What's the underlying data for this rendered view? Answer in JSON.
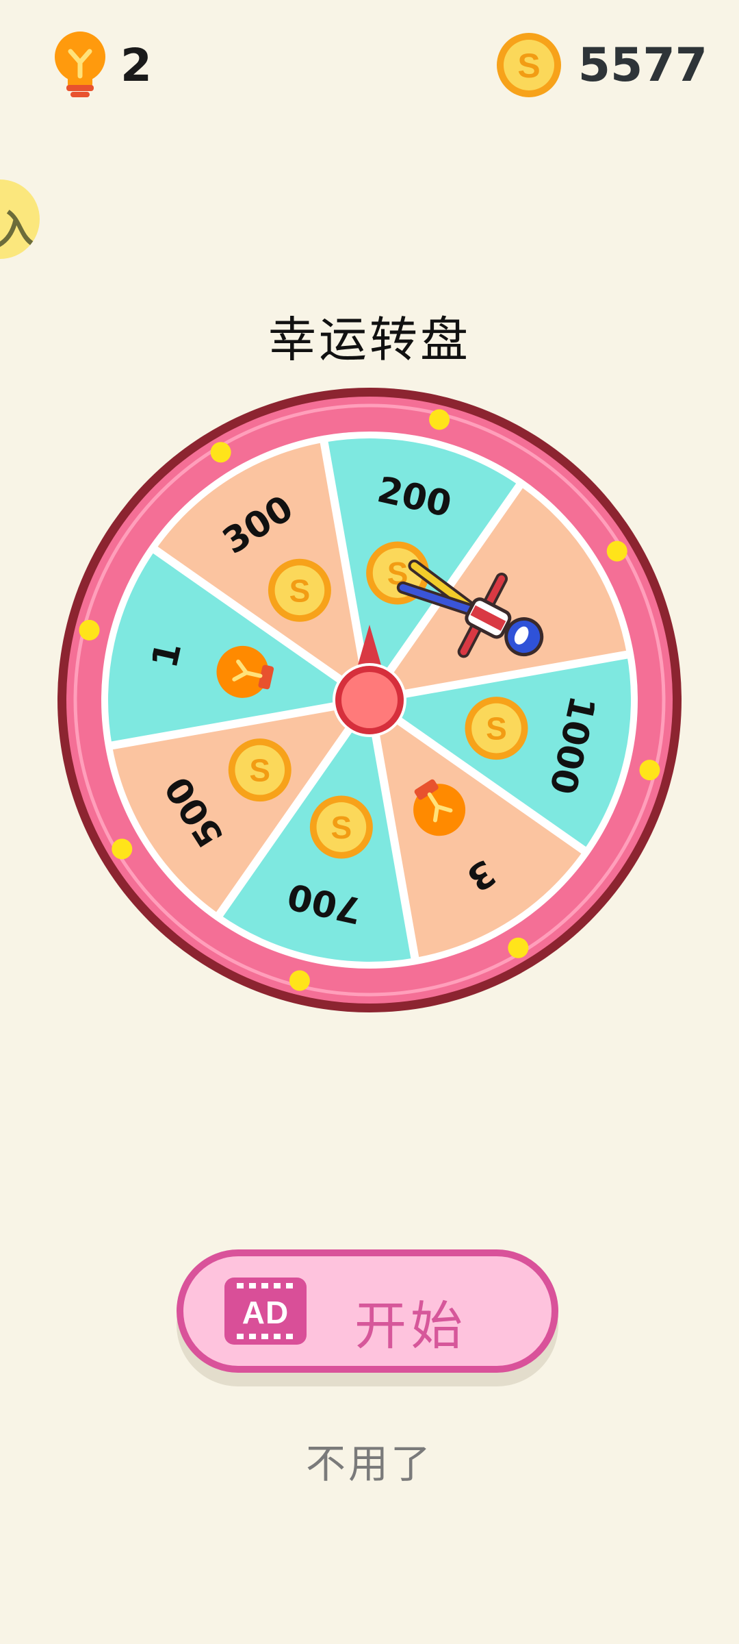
{
  "header": {
    "hint_count": "2",
    "coin_count": "5577",
    "hint_icon": "lightbulb-icon",
    "coin_icon": "coin-icon"
  },
  "side_badge": {
    "label": "入"
  },
  "title": "幸运转盘",
  "wheel": {
    "segments": [
      {
        "label": "200",
        "reward": "coins"
      },
      {
        "label": "",
        "reward": "skin"
      },
      {
        "label": "1000",
        "reward": "coins"
      },
      {
        "label": "3",
        "reward": "hints"
      },
      {
        "label": "700",
        "reward": "coins"
      },
      {
        "label": "500",
        "reward": "coins"
      },
      {
        "label": "1",
        "reward": "hints"
      },
      {
        "label": "300",
        "reward": "coins"
      }
    ],
    "colors": {
      "teal": "#7ee8e0",
      "peach": "#fbc4a0",
      "rim": "#f46f96",
      "rim_outer": "#8c2430",
      "pointer": "#d93943",
      "hub": "#ff7a7a",
      "lights": "#ffe41a"
    }
  },
  "button": {
    "ad_label": "AD",
    "start_label": "开始"
  },
  "skip_label": "不用了"
}
